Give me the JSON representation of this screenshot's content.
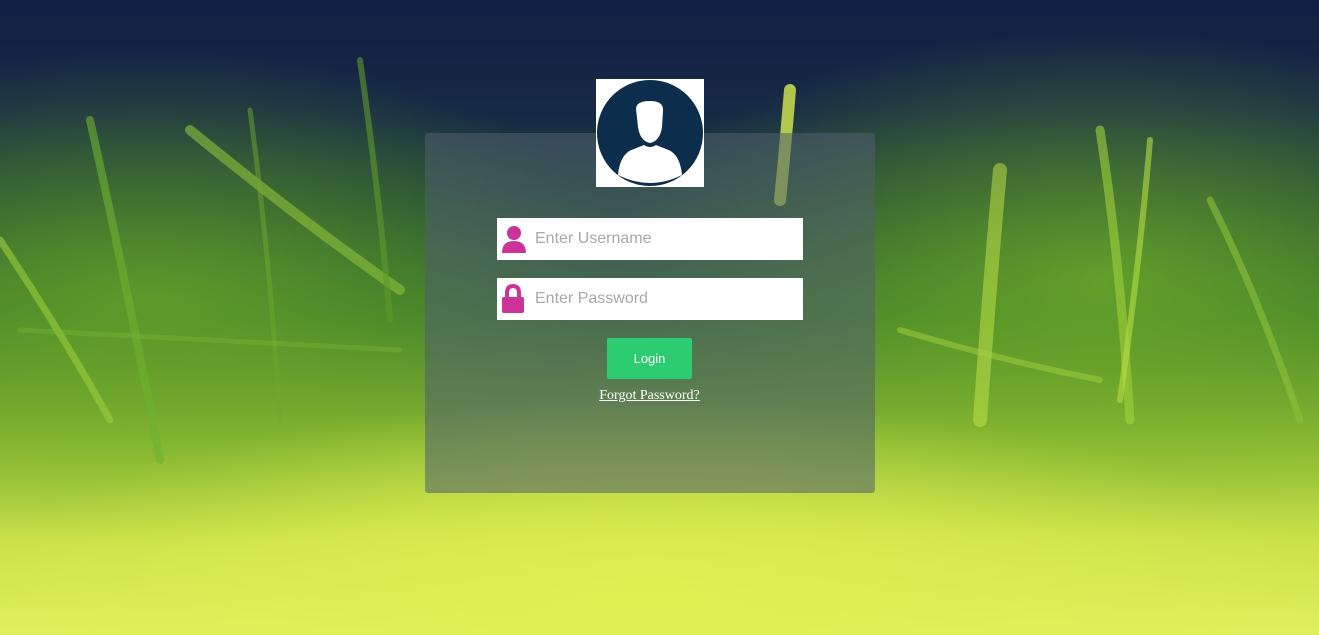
{
  "login_form": {
    "username_placeholder": "Enter Username",
    "password_placeholder": "Enter Password",
    "login_label": "Login",
    "forgot_label": "Forgot Password?"
  },
  "colors": {
    "accent": "#2ecc71",
    "icon": "#cc3399",
    "avatar": "#0c2d4b"
  }
}
